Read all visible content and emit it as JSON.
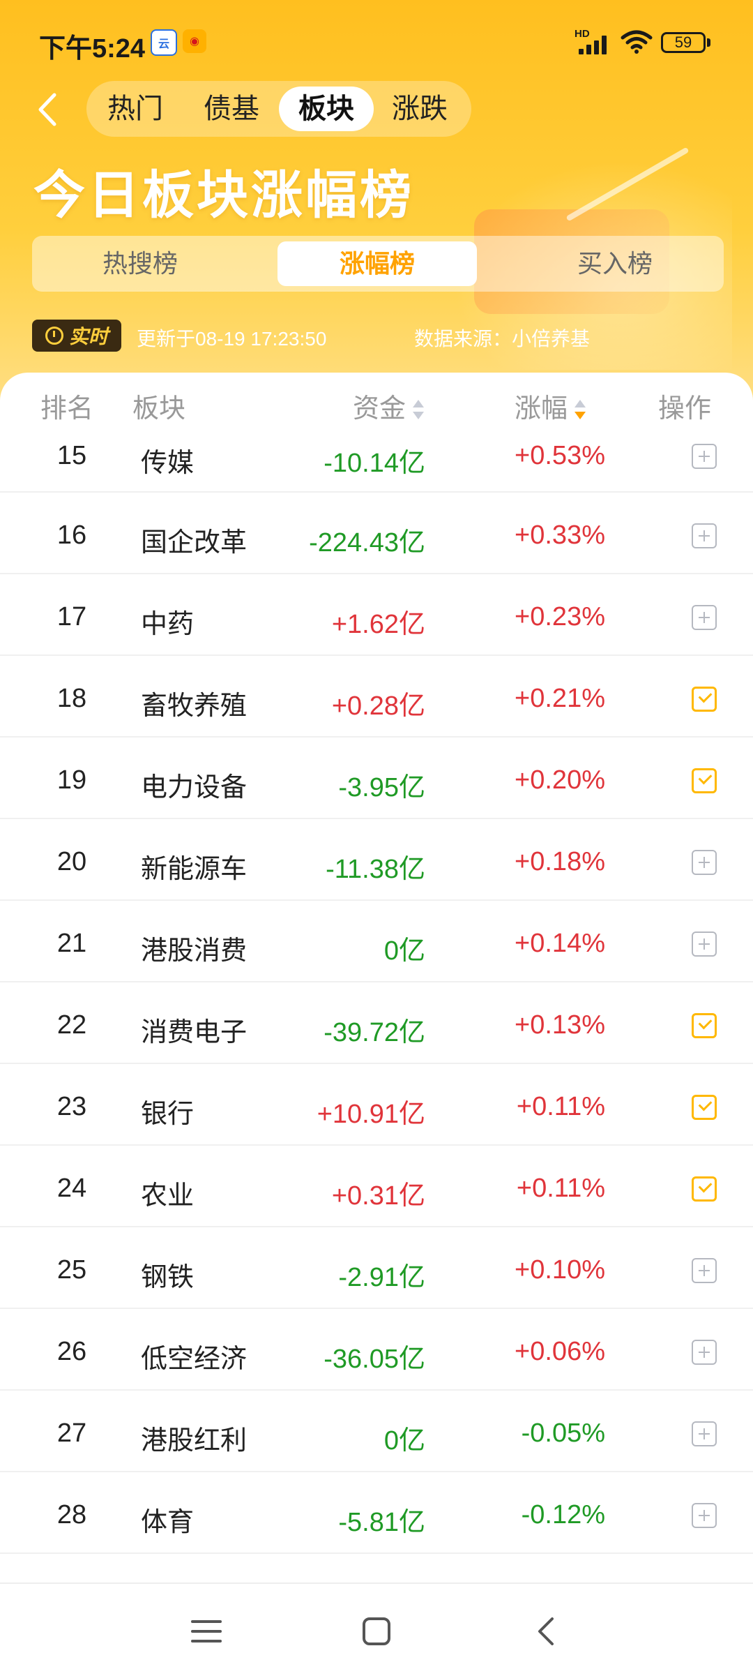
{
  "status_bar": {
    "time": "下午5:24",
    "battery": "59",
    "hd": "HD"
  },
  "nav": {
    "tabs": [
      {
        "label": "热门"
      },
      {
        "label": "债基"
      },
      {
        "label": "板块"
      },
      {
        "label": "涨跌"
      }
    ],
    "active_tab": "板块"
  },
  "title": "今日板块涨幅榜",
  "sub_tabs": [
    {
      "label": "热搜榜"
    },
    {
      "label": "涨幅榜"
    },
    {
      "label": "买入榜"
    }
  ],
  "info": {
    "live_label": "实时",
    "update_time": "更新于08-19 17:23:50",
    "data_source": "数据来源：小倍养基"
  },
  "columns": {
    "rank": "排名",
    "sector": "板块",
    "fund": "资金",
    "change": "涨幅",
    "action": "操作"
  },
  "colors": {
    "accent": "#ffa200",
    "up": "#e0343a",
    "down": "#1f9a25"
  },
  "rows": [
    {
      "rank": "15",
      "name": "传媒",
      "fund": "-10.14亿",
      "change": "+0.53%",
      "action": "add"
    },
    {
      "rank": "16",
      "name": "国企改革",
      "fund": "-224.43亿",
      "change": "+0.33%",
      "action": "add"
    },
    {
      "rank": "17",
      "name": "中药",
      "fund": "+1.62亿",
      "change": "+0.23%",
      "action": "add"
    },
    {
      "rank": "18",
      "name": "畜牧养殖",
      "fund": "+0.28亿",
      "change": "+0.21%",
      "action": "checked"
    },
    {
      "rank": "19",
      "name": "电力设备",
      "fund": "-3.95亿",
      "change": "+0.20%",
      "action": "checked"
    },
    {
      "rank": "20",
      "name": "新能源车",
      "fund": "-11.38亿",
      "change": "+0.18%",
      "action": "add"
    },
    {
      "rank": "21",
      "name": "港股消费",
      "fund": "0亿",
      "change": "+0.14%",
      "action": "add"
    },
    {
      "rank": "22",
      "name": "消费电子",
      "fund": "-39.72亿",
      "change": "+0.13%",
      "action": "checked"
    },
    {
      "rank": "23",
      "name": "银行",
      "fund": "+10.91亿",
      "change": "+0.11%",
      "action": "checked"
    },
    {
      "rank": "24",
      "name": "农业",
      "fund": "+0.31亿",
      "change": "+0.11%",
      "action": "checked"
    },
    {
      "rank": "25",
      "name": "钢铁",
      "fund": "-2.91亿",
      "change": "+0.10%",
      "action": "add"
    },
    {
      "rank": "26",
      "name": "低空经济",
      "fund": "-36.05亿",
      "change": "+0.06%",
      "action": "add"
    },
    {
      "rank": "27",
      "name": "港股红利",
      "fund": "0亿",
      "change": "-0.05%",
      "action": "add"
    },
    {
      "rank": "28",
      "name": "体育",
      "fund": "-5.81亿",
      "change": "-0.12%",
      "action": "add"
    }
  ]
}
